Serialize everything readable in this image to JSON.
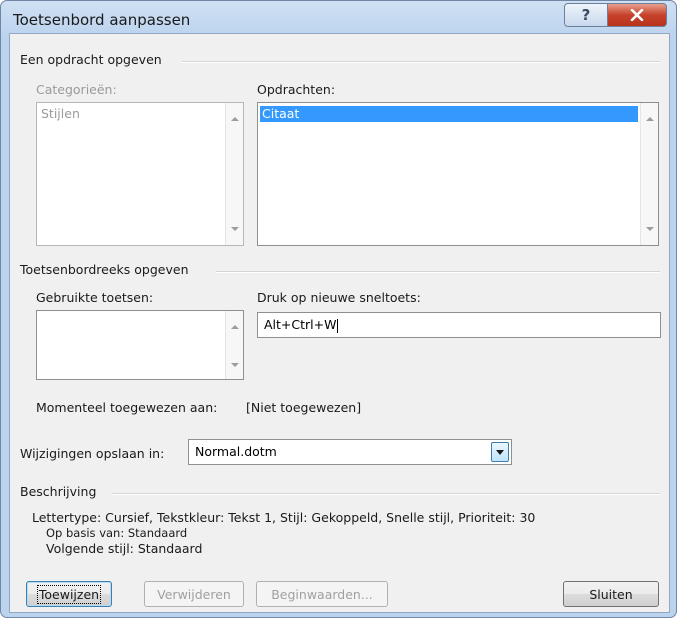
{
  "window": {
    "title": "Toetsenbord aanpassen",
    "help_glyph": "?",
    "close_glyph": "✕"
  },
  "command_section": {
    "heading": "Een opdracht opgeven",
    "categories_label": "Categorieën:",
    "categories_items": [
      "Stijlen"
    ],
    "commands_label": "Opdrachten:",
    "commands_items": [
      "Citaat"
    ]
  },
  "key_section": {
    "heading": "Toetsenbordreeks opgeven",
    "current_keys_label": "Gebruikte toetsen:",
    "current_keys_items": [],
    "new_key_label": "Druk op nieuwe sneltoets:",
    "new_key_value": "Alt+Ctrl+W",
    "assigned_label": "Momenteel toegewezen aan:",
    "assigned_value": "[Niet toegewezen]"
  },
  "save_in": {
    "label": "Wijzigingen opslaan in:",
    "value": "Normal.dotm"
  },
  "description": {
    "heading": "Beschrijving",
    "line1": "Lettertype: Cursief, Tekstkleur: Tekst 1, Stijl: Gekoppeld, Snelle stijl, Prioriteit: 30",
    "line2": "Op basis van: Standaard",
    "line3": "Volgende stijl: Standaard"
  },
  "buttons": {
    "assign": "Toewijzen",
    "remove": "Verwijderen",
    "reset": "Beginwaarden...",
    "close": "Sluiten"
  }
}
